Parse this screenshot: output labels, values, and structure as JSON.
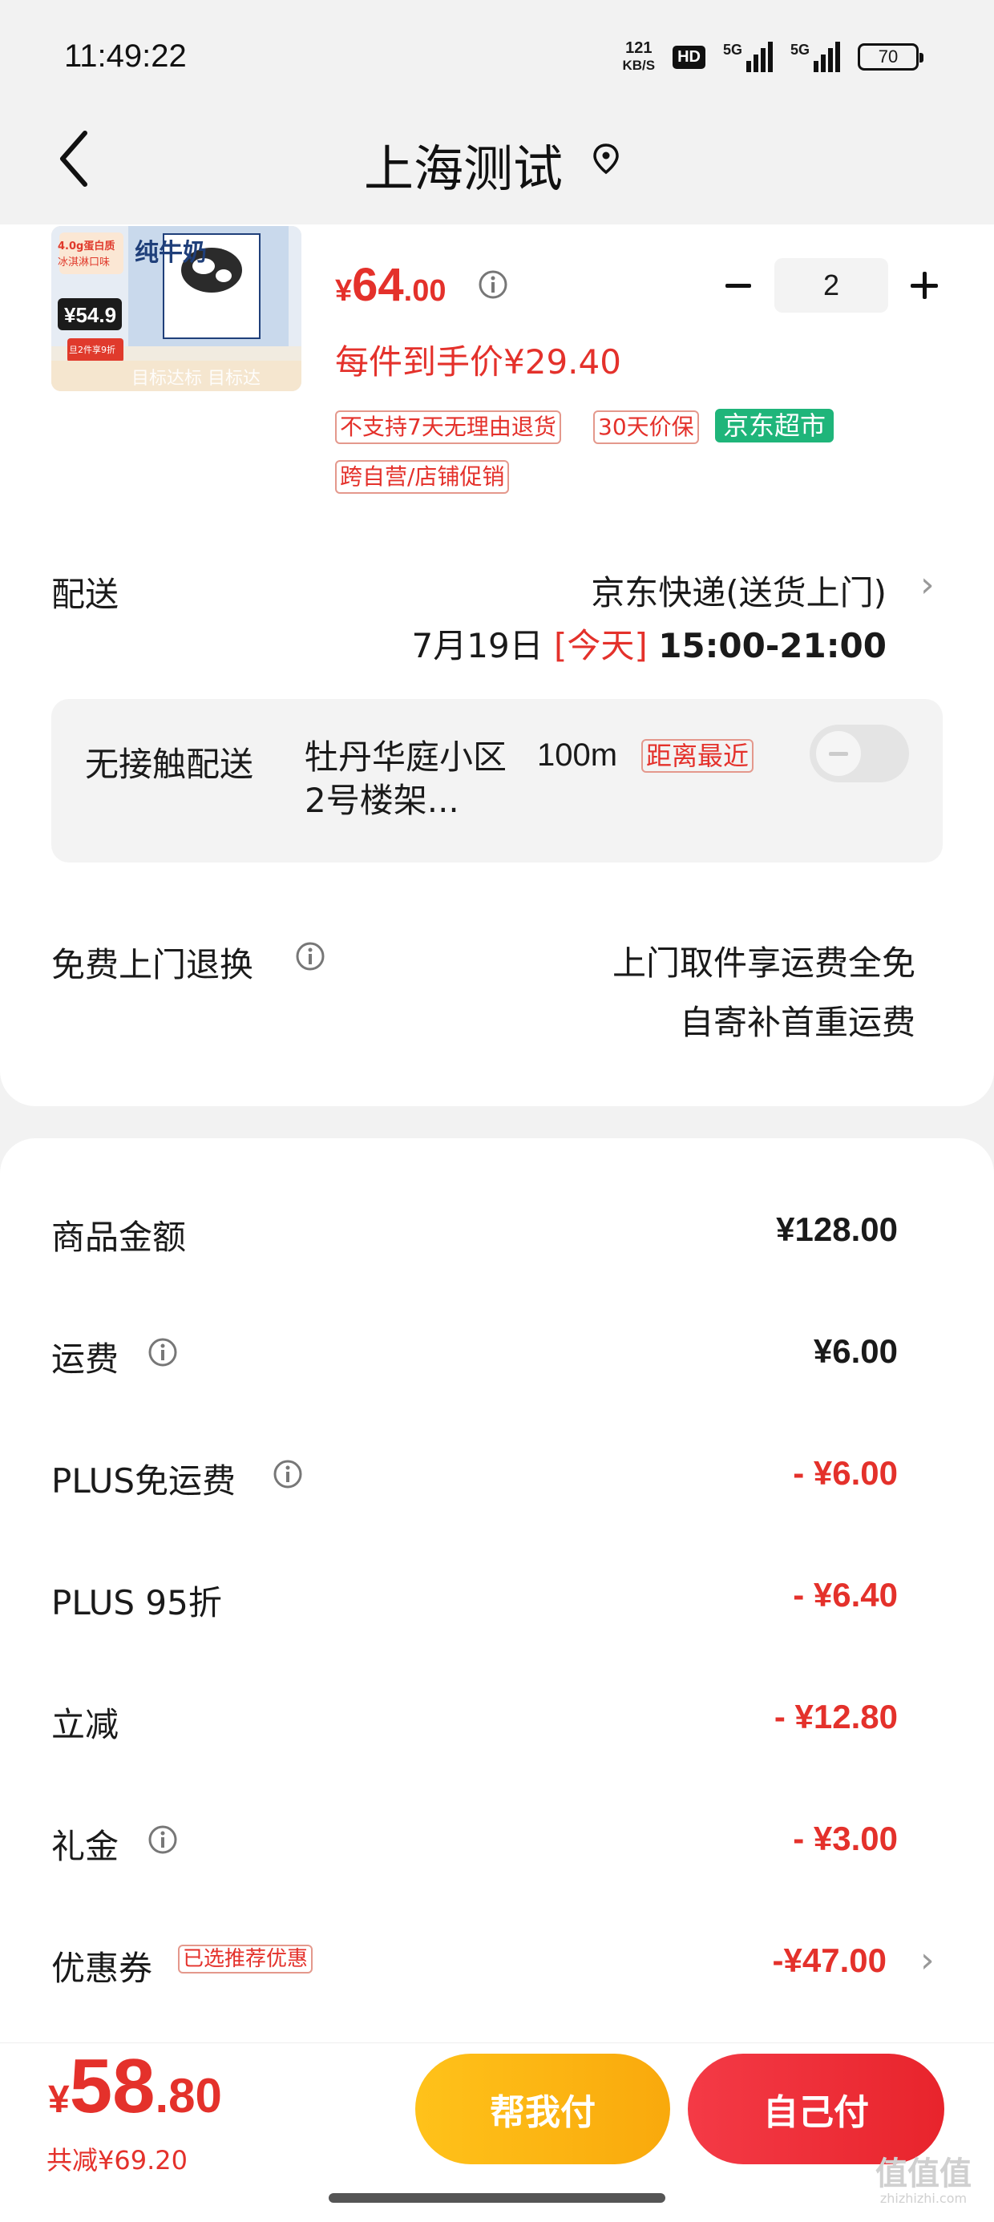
{
  "status_bar": {
    "time": "11:49:22",
    "net_speed_value": "121",
    "net_speed_unit": "KB/S",
    "hd_label": "HD",
    "signal1_label": "5G",
    "signal2_label": "5G",
    "battery": "70"
  },
  "nav": {
    "title": "上海测试",
    "back_icon": "chevron-left-icon",
    "location_icon": "location-pin-icon"
  },
  "product": {
    "image_icon": "milk-product-image",
    "image_text": {
      "brand": "纯牛奶",
      "protein": "4.0g蛋白质",
      "flavor": "冰淇淋口味",
      "badge_price": "54.9",
      "promo": "旦2件享9折",
      "footer": "目标达标 目标达"
    },
    "price_currency": "¥",
    "price_int": "64",
    "price_dec": ".00",
    "unit_price": "每件到手价¥29.40",
    "quantity": "2",
    "tags": [
      "不支持7天无理由退货",
      "30天价保",
      "京东超市",
      "跨自营/店铺促销"
    ]
  },
  "delivery": {
    "label": "配送",
    "method": "京东快递(送货上门)",
    "date": "7月19日",
    "today": "[今天]",
    "hours": "15:00-21:00",
    "contactless_label": "无接触配送",
    "contactless_address": "牡丹华庭小区2号楼架...",
    "distance": "100m",
    "nearest_tag": "距离最近",
    "toggle_on": false
  },
  "returns": {
    "label": "免费上门退换",
    "line1": "上门取件享运费全免",
    "line2": "自寄补首重运费"
  },
  "fees": [
    {
      "label": "商品金额",
      "value": "¥128.00",
      "info": false,
      "red": false
    },
    {
      "label": "运费",
      "value": "¥6.00",
      "info": true,
      "red": false
    },
    {
      "label": "PLUS免运费",
      "value": "- ¥6.00",
      "info": true,
      "red": true
    },
    {
      "label": "PLUS 95折",
      "value": "- ¥6.40",
      "info": false,
      "red": true
    },
    {
      "label": "立减",
      "value": "- ¥12.80",
      "info": false,
      "red": true
    },
    {
      "label": "礼金",
      "value": "- ¥3.00",
      "info": true,
      "red": true
    },
    {
      "label": "优惠券",
      "value": "-¥47.00",
      "info": false,
      "red": true
    }
  ],
  "coupon_tag": "已选推荐优惠",
  "footer": {
    "total_currency": "¥",
    "total_int": "58",
    "total_dec": ".80",
    "saved": "共减¥69.20",
    "help_pay": "帮我付",
    "self_pay": "自己付"
  },
  "watermark": {
    "main": "值值值",
    "sub": "zhizhizhi.com"
  },
  "colors": {
    "accent_red": "#e4312b",
    "jd_green": "#1fb57a",
    "help_btn": "#f9a90c",
    "self_btn": "#e8242c"
  }
}
